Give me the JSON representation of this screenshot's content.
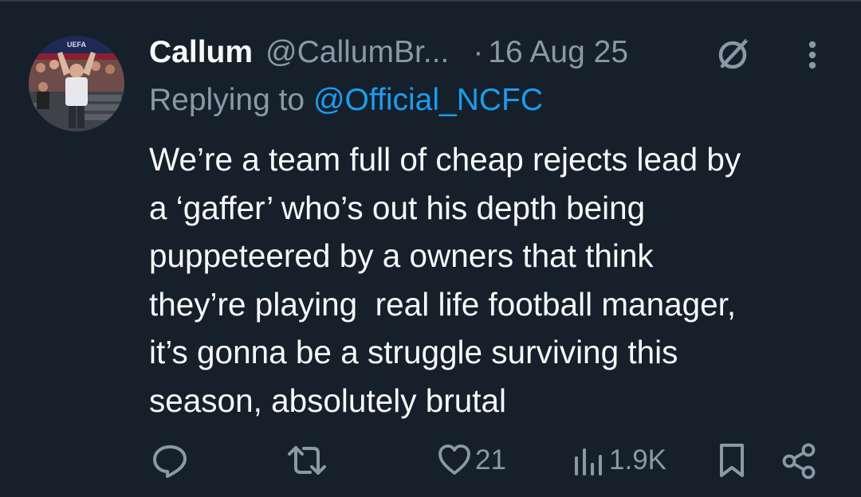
{
  "tweet": {
    "author_name": "Callum",
    "author_handle": "@CallumBr...",
    "separator": "·",
    "date": "16 Aug 25",
    "replying_prefix": "Replying to ",
    "replying_to": "@Official_NCFC",
    "text_lines": [
      "We’re a team full of cheap rejects lead by",
      "a ‘gaffer’ who’s out his depth being",
      "puppeteered by a owners that think",
      "they’re playing  real life football manager,",
      "it’s gonna be a struggle surviving this",
      "season, absolutely brutal"
    ],
    "avatar_banner_text": "UEFA"
  },
  "actions": {
    "reply_icon": "reply-icon",
    "retweet_icon": "retweet-icon",
    "like_icon": "heart-icon",
    "like_count": "21",
    "views_icon": "views-icon",
    "views_count": "1.9K",
    "bookmark_icon": "bookmark-icon",
    "share_icon": "share-icon"
  },
  "colors": {
    "background": "#15202b",
    "text_primary": "#f7f9f9",
    "text_secondary": "#8b98a5",
    "accent_blue": "#1d9bf0"
  }
}
